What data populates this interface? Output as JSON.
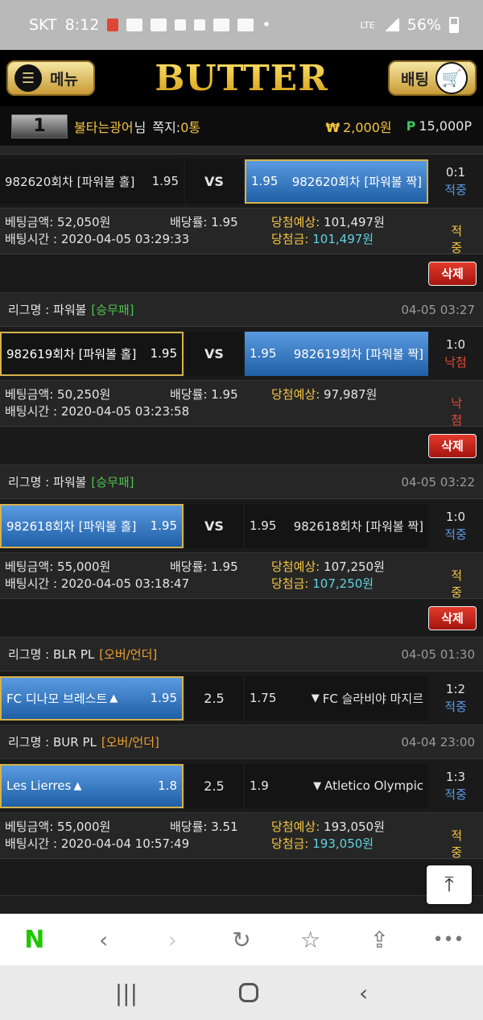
{
  "status": {
    "carrier": "SKT",
    "time": "8:12",
    "battery": "56%",
    "network": "LTE"
  },
  "header": {
    "menu_label": "메뉴",
    "logo": "BUTTER",
    "bet_label": "배팅"
  },
  "user": {
    "level": "1",
    "name": "불타는광어",
    "suffix": "님",
    "messages": "쪽지:",
    "messages_count": "0통",
    "money_symbol": "₩",
    "money": "2,000원",
    "points_symbol": "P",
    "points": "15,000P"
  },
  "labels": {
    "vs": "VS",
    "bet_amount": "베팅금액:",
    "dividend": "배당률:",
    "expected": "당첨예상:",
    "bet_time": "배팅시간 :",
    "win_amount": "당첨금:",
    "delete": "삭제",
    "league": "리그명 :"
  },
  "bet1": {
    "home": "982620회차 [파워볼 홀]",
    "home_odds": "1.95",
    "away": "982620회차 [파워볼 짝]",
    "away_odds": "1.95",
    "score": "0:1",
    "status": "적중",
    "amount": "52,050원",
    "rate": "1.95",
    "expected": "101,497원",
    "time": "2020-04-05 03:29:33",
    "win": "101,497원",
    "result": "적중"
  },
  "bet2": {
    "league": "파워볼",
    "category": "[승무패]",
    "date": "04-05 03:27",
    "home": "982619회차 [파워볼 홀]",
    "home_odds": "1.95",
    "away": "982619회차 [파워볼 짝]",
    "away_odds": "1.95",
    "score": "1:0",
    "status": "낙첨",
    "amount": "50,250원",
    "rate": "1.95",
    "expected": "97,987원",
    "time": "2020-04-05 03:23:58",
    "result": "낙첨"
  },
  "bet3": {
    "league": "파워볼",
    "category": "[승무패]",
    "date": "04-05 03:22",
    "home": "982618회차 [파워볼 홀]",
    "home_odds": "1.95",
    "away": "982618회차 [파워볼 짝]",
    "away_odds": "1.95",
    "score": "1:0",
    "status": "적중",
    "amount": "55,000원",
    "rate": "1.95",
    "expected": "107,250원",
    "time": "2020-04-05 03:18:47",
    "win": "107,250원",
    "result": "적중"
  },
  "bet4": {
    "g1": {
      "league": "BLR PL",
      "category": "[오버/언더]",
      "date": "04-05 01:30",
      "home": "FC 디나모 브레스트",
      "home_odds": "1.95",
      "line": "2.5",
      "away": "FC 슬라비야 마지르",
      "away_odds": "1.75",
      "score": "1:2",
      "status": "적중"
    },
    "g2": {
      "league": "BUR PL",
      "category": "[오버/언더]",
      "date": "04-04 23:00",
      "home": "Les Lierres",
      "home_odds": "1.8",
      "line": "2.5",
      "away": "Atletico Olympic",
      "away_odds": "1.9",
      "score": "1:3",
      "status": "적중"
    },
    "amount": "55,000원",
    "rate": "3.51",
    "expected": "193,050원",
    "time": "2020-04-04 10:57:49",
    "win": "193,050원",
    "result": "적중"
  },
  "icons": {
    "up": "▲",
    "down": "▼"
  },
  "colors": {
    "accent_gold": "#f5c542",
    "win_blue": "#5b9ae8",
    "lose_red": "#e24a3a",
    "selected_blue": "#1f5fa6",
    "delete_red": "#c8241a",
    "naver_green": "#1ec800"
  }
}
